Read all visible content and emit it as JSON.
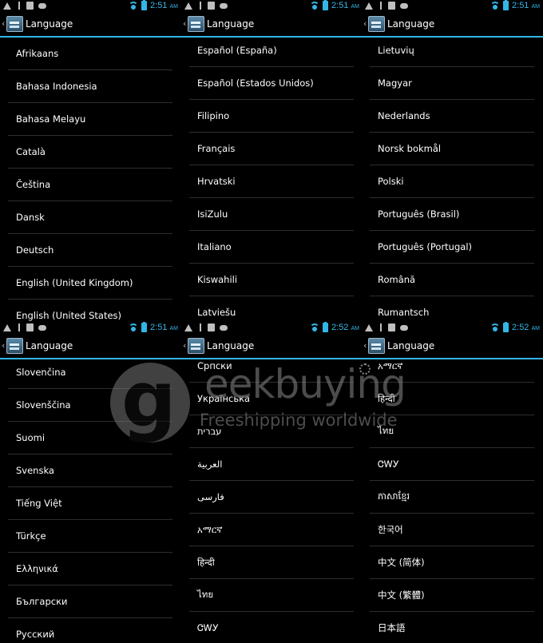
{
  "status": {
    "times": [
      "2:51",
      "2:51",
      "2:51",
      "2:51",
      "2:52",
      "2:52"
    ],
    "ampm": "AM",
    "accent": "#33b5e5"
  },
  "action_bar": {
    "title": "Language",
    "back": "‹"
  },
  "panels": [
    [
      "Afrikaans",
      "Bahasa Indonesia",
      "Bahasa Melayu",
      "Català",
      "Čeština",
      "Dansk",
      "Deutsch",
      "English (United Kingdom)",
      "English (United States)"
    ],
    [
      "Español (España)",
      "Español (Estados Unidos)",
      "Filipino",
      "Français",
      "Hrvatski",
      "IsiZulu",
      "Italiano",
      "Kiswahili",
      "Latviešu"
    ],
    [
      "Lietuvių",
      "Magyar",
      "Nederlands",
      "Norsk bokmål",
      "Polski",
      "Português (Brasil)",
      "Português (Portugal)",
      "Română",
      "Rumantsch"
    ],
    [
      "Slovenčina",
      "Slovenščina",
      "Suomi",
      "Svenska",
      "Tiếng Việt",
      "Türkçe",
      "Ελληνικά",
      "Български",
      "Русский"
    ],
    [
      "Српски",
      "Українська",
      "עברית",
      "العربية",
      "فارسی",
      "አማርኛ",
      "हिन्दी",
      "ไทย",
      "ᏣᎳᎩ"
    ],
    [
      "አማርኛ",
      "हिन्दी",
      "ไทย",
      "ᏣᎳᎩ",
      "ភាសាខ្មែរ",
      "한국어",
      "中文 (简体)",
      "中文 (繁體)",
      "日本語"
    ]
  ],
  "watermark": {
    "logo_letter": "g",
    "word": "eekbuying",
    "tagline": "Freeshipping worldwide"
  }
}
